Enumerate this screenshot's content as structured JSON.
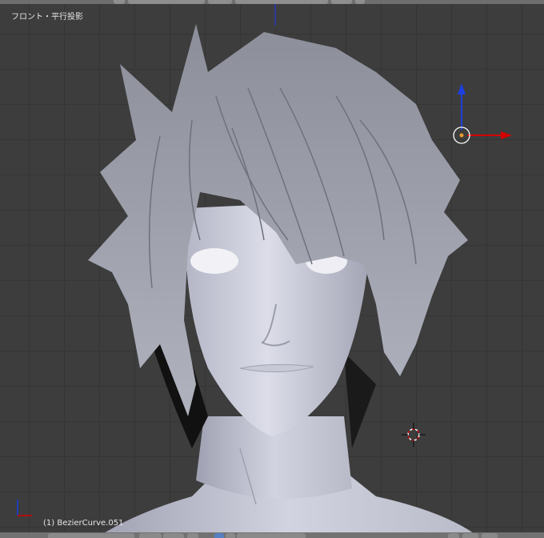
{
  "viewport": {
    "view_name": "フロント・平行投影",
    "active_object": "(1) BezierCurve.051"
  },
  "colors": {
    "background": "#3d3d3d",
    "grid": "#353535",
    "axis_x": "#d40000",
    "axis_z": "#1d3fe0",
    "z_axis_line": "#2b3bb8",
    "origin_dot": "#e89a2c",
    "mesh_light": "#d6d8e6",
    "mesh_dark": "#8a8c9c",
    "hair_shadow": "#111111"
  },
  "icons": {
    "transform_gizmo": "manipulator-icon",
    "cursor": "3d-cursor-icon",
    "axis_indicator": "axis-indicator-icon"
  }
}
